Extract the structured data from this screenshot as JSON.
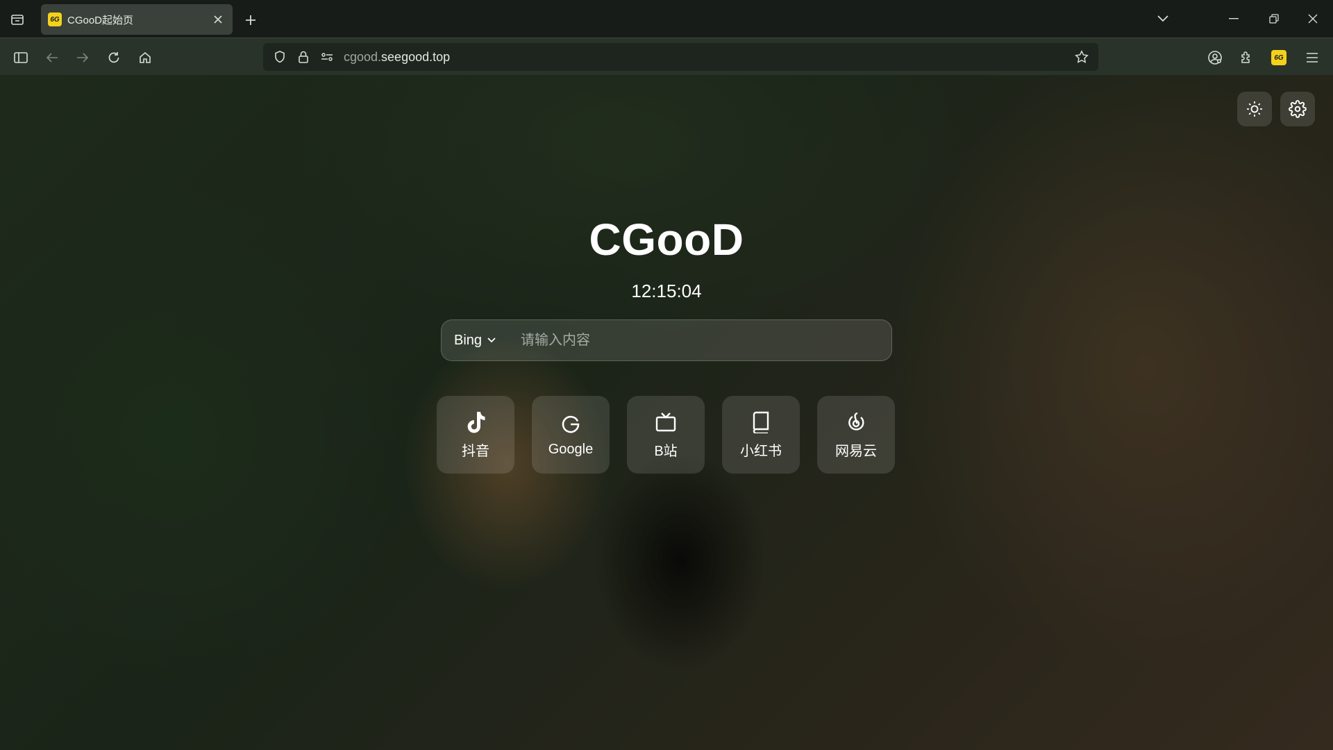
{
  "browser": {
    "tab": {
      "title": "CGooD起始页",
      "favicon_text": "6G"
    },
    "url": {
      "prefix": "cgood.",
      "host": "seegood.top"
    },
    "extension_badge": "6G"
  },
  "page": {
    "logo": "CGooD",
    "clock": "12:15:04",
    "search": {
      "engine": "Bing",
      "placeholder": "请输入内容"
    },
    "shortcuts": [
      {
        "label": "抖音",
        "icon": "tiktok-icon"
      },
      {
        "label": "Google",
        "icon": "google-icon"
      },
      {
        "label": "B站",
        "icon": "tv-icon"
      },
      {
        "label": "小红书",
        "icon": "book-icon"
      },
      {
        "label": "网易云",
        "icon": "netease-music-icon"
      }
    ],
    "corner_buttons": [
      "sun-icon",
      "gear-icon"
    ]
  },
  "colors": {
    "accent_yellow": "#f4d21c",
    "chrome_dark": "#181c18",
    "toolbar": "#2a332a"
  }
}
